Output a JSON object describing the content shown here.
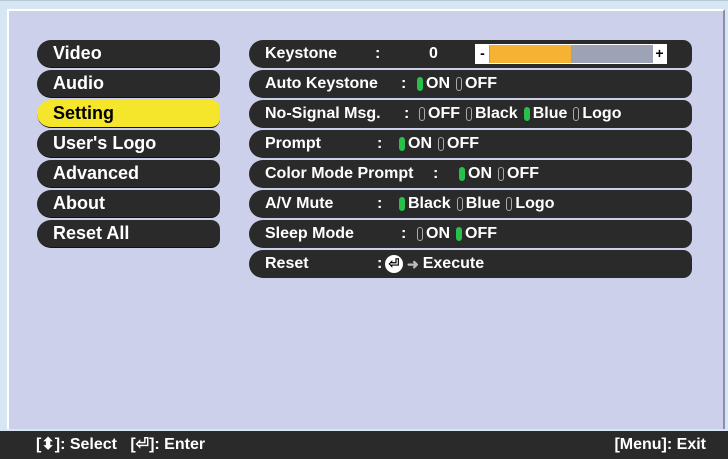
{
  "menu": {
    "items": [
      {
        "label": "Video"
      },
      {
        "label": "Audio"
      },
      {
        "label": "Setting"
      },
      {
        "label": "User's Logo"
      },
      {
        "label": "Advanced"
      },
      {
        "label": "About"
      },
      {
        "label": "Reset All"
      }
    ],
    "selected_index": 2
  },
  "settings": {
    "keystone": {
      "label": "Keystone",
      "value": "0",
      "minus": "-",
      "plus": "+",
      "level_fraction": 0.5
    },
    "auto_keystone": {
      "label": "Auto Keystone",
      "opts": [
        "ON",
        "OFF"
      ],
      "selected": "ON"
    },
    "no_signal": {
      "label": "No-Signal Msg.",
      "opts": [
        "OFF",
        "Black",
        "Blue",
        "Logo"
      ],
      "selected": "Blue"
    },
    "prompt": {
      "label": "Prompt",
      "opts": [
        "ON",
        "OFF"
      ],
      "selected": "ON"
    },
    "color_mode_prompt": {
      "label": "Color Mode Prompt",
      "opts": [
        "ON",
        "OFF"
      ],
      "selected": "ON"
    },
    "av_mute": {
      "label": "A/V Mute",
      "opts": [
        "Black",
        "Blue",
        "Logo"
      ],
      "selected": "Black"
    },
    "sleep_mode": {
      "label": "Sleep Mode",
      "opts": [
        "ON",
        "OFF"
      ],
      "selected": "OFF"
    },
    "reset": {
      "label": "Reset",
      "action": "Execute"
    }
  },
  "footer": {
    "select_hint": "[⬍]: Select",
    "enter_hint": "[⏎]: Enter",
    "exit_hint": "[Menu]: Exit"
  },
  "colors": {
    "background": "#ccd0ea",
    "item_bg": "#2a2a2a",
    "selected_bg": "#f5e62c",
    "on_indicator": "#27c04a",
    "bar_fill": "#f5b233"
  }
}
